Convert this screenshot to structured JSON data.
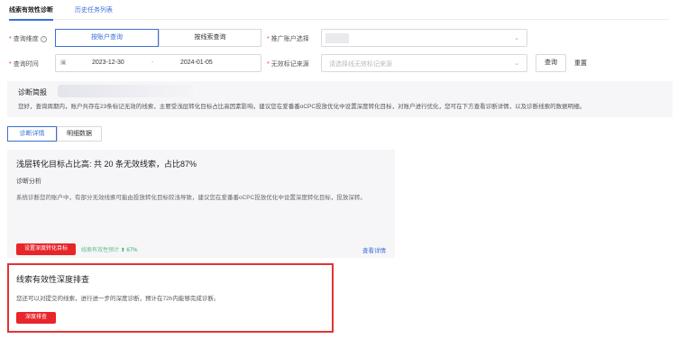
{
  "tabs": {
    "diagnosis": "线索有效性诊断",
    "history": "历史任务列表"
  },
  "filters": {
    "dimension_label": "查询维度",
    "dimension_options": [
      "按账户查询",
      "按线索查询"
    ],
    "account_label": "推广账户选择",
    "time_label": "查询时间",
    "date_start": "2023-12-30",
    "date_sep": "-",
    "date_end": "2024-01-05",
    "source_label": "无效标记来源",
    "source_placeholder": "请选择线无效标记来源",
    "query_button": "查询",
    "reset_button": "重置"
  },
  "brief": {
    "title": "诊断简报",
    "text": "您好，查询周期内，账户共存在23条标记无效的线索，主要受浅层转化目标占比高因素影响，建议您在爱番番oCPC投放优化中设置深度转化目标，对账户进行优化，您可在下方查看诊断详情，以及诊断线索的数据明细。"
  },
  "subtabs": [
    "诊断详情",
    "明细数据"
  ],
  "card1": {
    "title": "浅层转化目标占比高: 共 20 条无效线索，占比87%",
    "heading": "诊断分析",
    "desc": "系统诊断您的账户中，有部分无效线索可能由投放转化目标较浅导致，建议您在爱番番oCPC投放优化中设置深度转化目标，投放深转。",
    "action_button": "设置深度转化目标",
    "metric_label": "线索有效性预计",
    "metric_value": "67%",
    "metric_arrow": "⬆",
    "link": "查看详情"
  },
  "card2": {
    "title": "线索有效性深度排查",
    "desc": "您还可以对提交的线索，进行进一步的深度诊断，预计在72h内能够完成诊断。",
    "action_button": "深度排查"
  },
  "icons": {
    "question": "?",
    "calendar": "▣",
    "chevron_down": "⌄",
    "metric_arrow": "⬆"
  },
  "colors": {
    "accent": "#3b6fd6",
    "danger": "#e8252a",
    "success": "#33b06a",
    "highlight_border": "#e03434"
  }
}
